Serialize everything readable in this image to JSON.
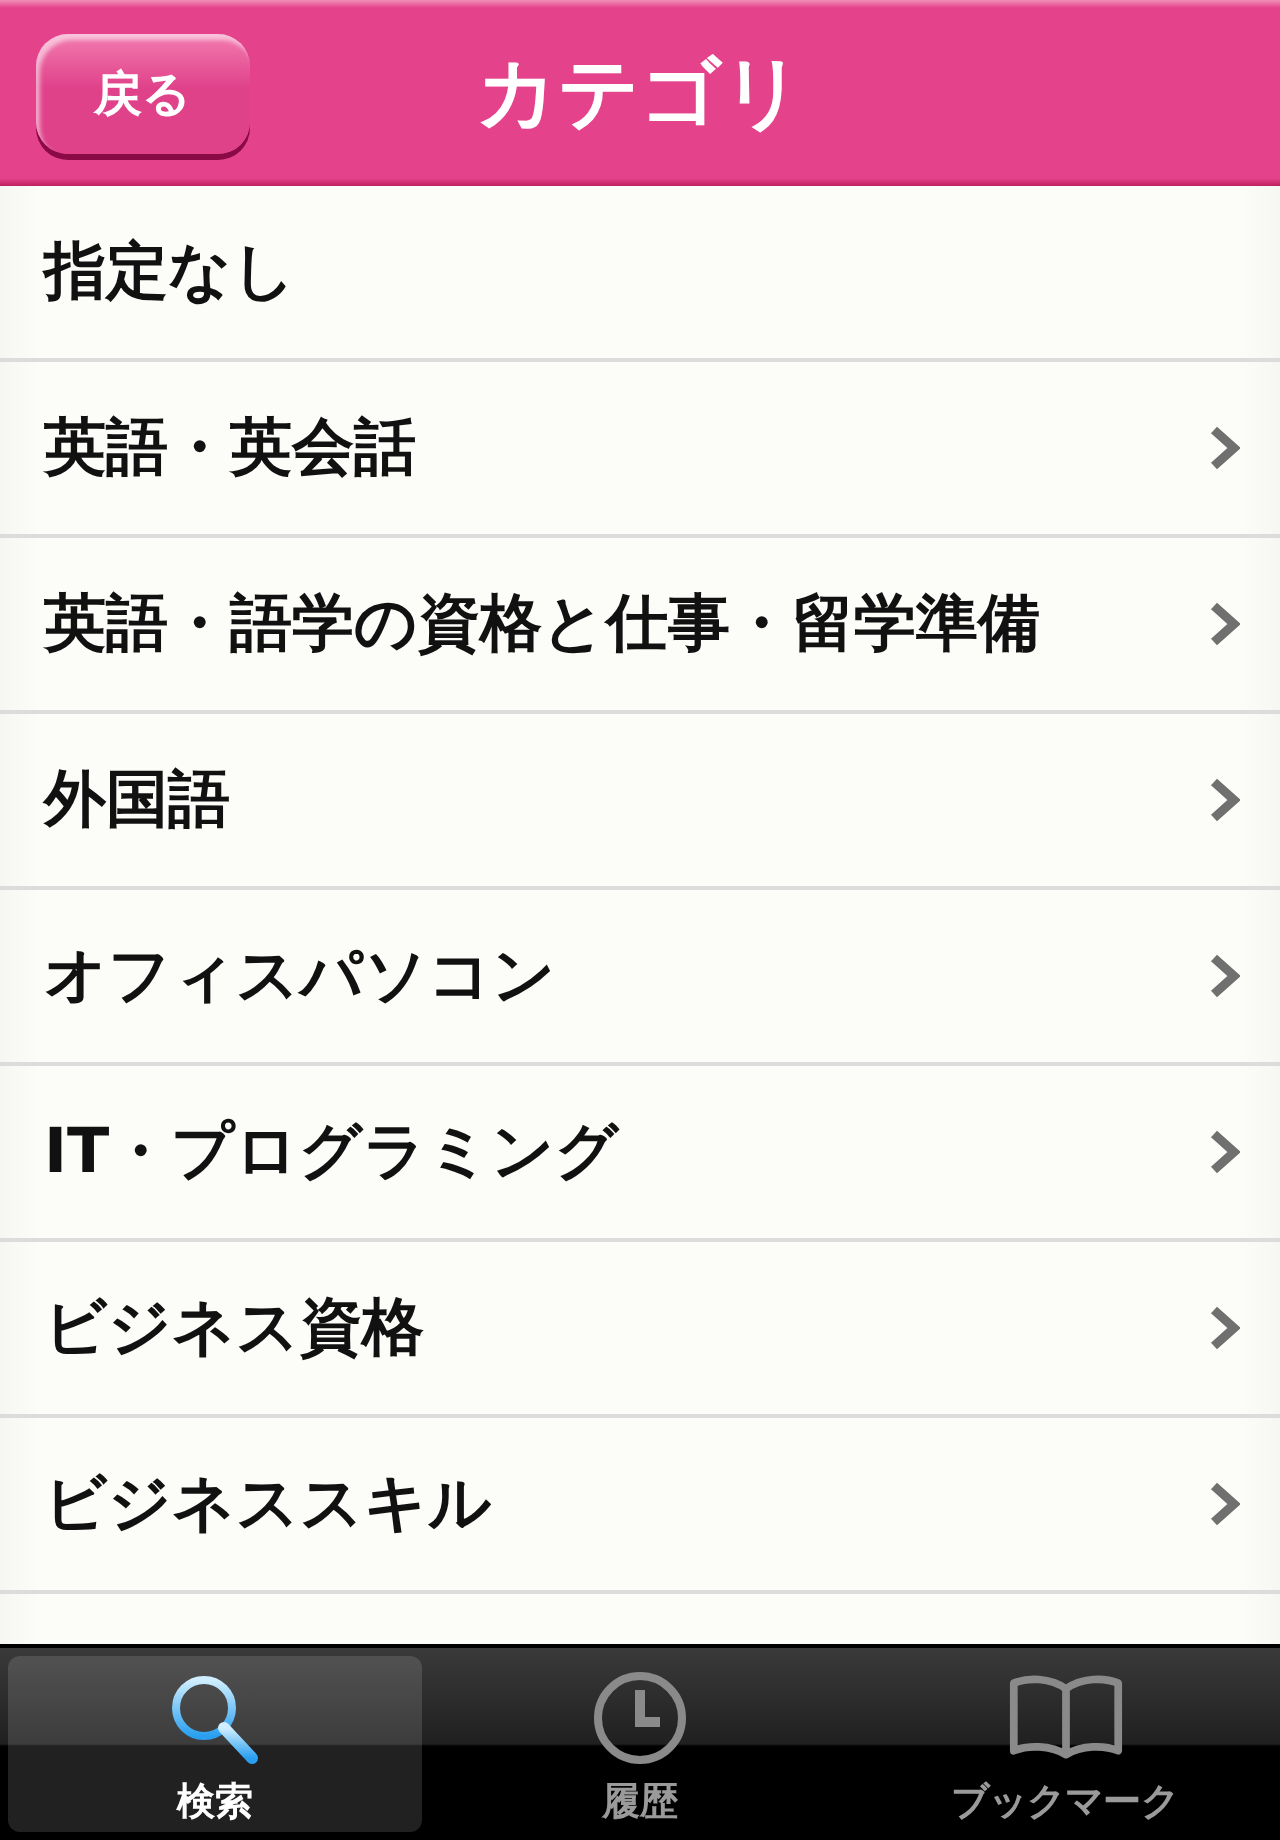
{
  "nav_bar": {
    "back_button": "戻る",
    "title": "カテゴリ"
  },
  "categories": [
    {
      "label": "指定なし",
      "disclosure": false
    },
    {
      "label": "英語・英会話",
      "disclosure": true
    },
    {
      "label": "英語・語学の資格と仕事・留学準備",
      "disclosure": true
    },
    {
      "label": "外国語",
      "disclosure": true
    },
    {
      "label": "オフィスパソコン",
      "disclosure": true
    },
    {
      "label": "IT・プログラミング",
      "disclosure": true
    },
    {
      "label": "ビジネス資格",
      "disclosure": true
    },
    {
      "label": "ビジネススキル",
      "disclosure": true
    }
  ],
  "tab_bar": [
    {
      "kind": "search",
      "label": "検索",
      "selected": true
    },
    {
      "kind": "history",
      "label": "履歴",
      "selected": false
    },
    {
      "kind": "bookmark",
      "label": "ブックマーク",
      "selected": false
    }
  ]
}
